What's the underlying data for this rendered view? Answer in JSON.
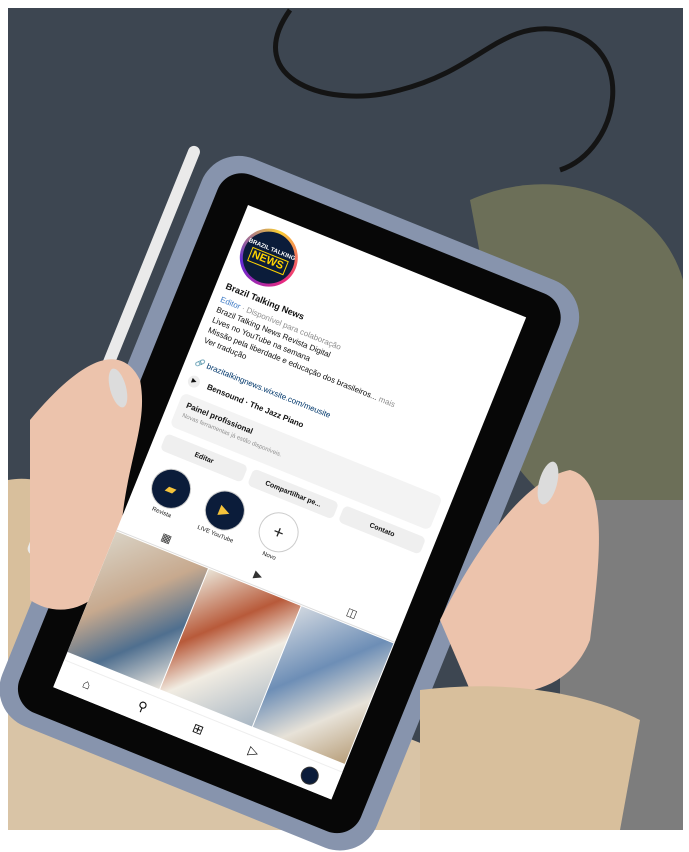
{
  "profile": {
    "avatar_line1": "BRAZIL TALKING",
    "avatar_line2": "NEWS",
    "name": "Brazil Talking News",
    "category": "Editor",
    "availability": "· Disponível para colaboração",
    "bio_lines": [
      "Brazil Talking News Revista Digital",
      "Lives no YouTube na semana",
      "Missão pela liberdade e educação dos brasileiros...",
      "Ver tradução"
    ],
    "more": "mais",
    "link": "brazitalkingnews.wixsite.com/meusite",
    "music": "Bensound · The Jazz Piano"
  },
  "dashboard": {
    "title": "Painel profissional",
    "subtitle": "Novas ferramentas já estão disponíveis."
  },
  "actions": {
    "edit": "Editar",
    "share": "Compartilhar pe...",
    "contact": "Contato"
  },
  "highlights": [
    {
      "label": "Revista",
      "icon": "magazine-icon"
    },
    {
      "label": "LIVE YouTube",
      "icon": "play-icon"
    },
    {
      "label": "Novo",
      "icon": "plus-icon"
    }
  ],
  "tabs": [
    {
      "icon": "grid-icon",
      "glyph": "▦"
    },
    {
      "icon": "reels-icon",
      "glyph": "▶"
    },
    {
      "icon": "tagged-icon",
      "glyph": "◫"
    }
  ],
  "nav": [
    {
      "icon": "home-icon",
      "glyph": "⌂"
    },
    {
      "icon": "search-icon",
      "glyph": "⚲"
    },
    {
      "icon": "create-icon",
      "glyph": "⊞"
    },
    {
      "icon": "reels-icon",
      "glyph": "▷"
    },
    {
      "icon": "profile-avatar-icon",
      "glyph": ""
    }
  ],
  "colors": {
    "ipad_case": "#8794ad",
    "sweater": "#d8bf9c",
    "pants": "#6c6f58",
    "background": "#3d4651",
    "brand_navy": "#0b1c3a",
    "brand_yellow": "#ffd400"
  }
}
